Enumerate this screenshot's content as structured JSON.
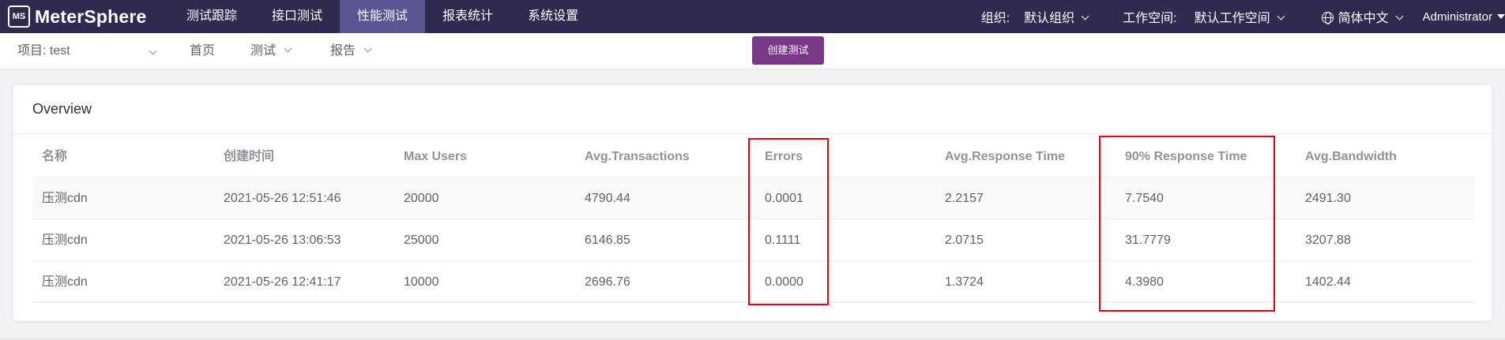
{
  "app": {
    "logo_text": "MeterSphere",
    "logo_mark": "MS"
  },
  "nav": {
    "items": [
      "测试跟踪",
      "接口测试",
      "性能测试",
      "报表统计",
      "系统设置"
    ],
    "active_index": 2
  },
  "top_right": {
    "org_label": "组织:",
    "org_value": "默认组织",
    "workspace_label": "工作空间:",
    "workspace_value": "默认工作空间",
    "language": "简体中文",
    "user": "Administrator"
  },
  "subbar": {
    "project": "项目: test",
    "home": "首页",
    "test": "测试",
    "report": "报告",
    "create_button": "创建测试"
  },
  "overview": {
    "title": "Overview",
    "columns": [
      "名称",
      "创建时间",
      "Max Users",
      "Avg.Transactions",
      "Errors",
      "Avg.Response Time",
      "90% Response Time",
      "Avg.Bandwidth"
    ],
    "rows": [
      [
        "压测cdn",
        "2021-05-26 12:51:46",
        "20000",
        "4790.44",
        "0.0001",
        "2.2157",
        "7.7540",
        "2491.30"
      ],
      [
        "压测cdn",
        "2021-05-26 13:06:53",
        "25000",
        "6146.85",
        "0.1111",
        "2.0715",
        "31.7779",
        "3207.88"
      ],
      [
        "压测cdn",
        "2021-05-26 12:41:17",
        "10000",
        "2696.76",
        "0.0000",
        "1.3724",
        "4.3980",
        "1402.44"
      ]
    ]
  },
  "colors": {
    "topbar": "#2f2a4e",
    "nav_active": "#5a5593",
    "create_button": "#783887",
    "highlight_box": "#e60012"
  }
}
